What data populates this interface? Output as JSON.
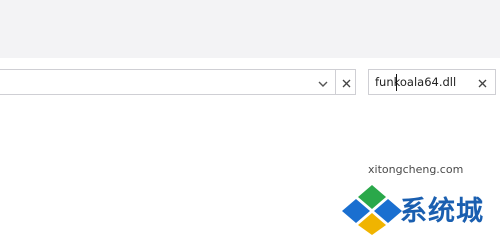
{
  "search": {
    "value": "funkoala64.dll",
    "clear_glyph": "×"
  },
  "address_bar": {
    "dropdown_glyph": "⌄",
    "clear_glyph": "×"
  },
  "watermark": {
    "url": "xitongcheng.com",
    "brand_text": "系统城",
    "colors": {
      "blue": "#1a5fb0",
      "green": "#2aa84a"
    }
  },
  "icons": [
    "chevron-down-icon",
    "close-icon",
    "close-icon",
    "xitongcheng-logo-icon"
  ]
}
